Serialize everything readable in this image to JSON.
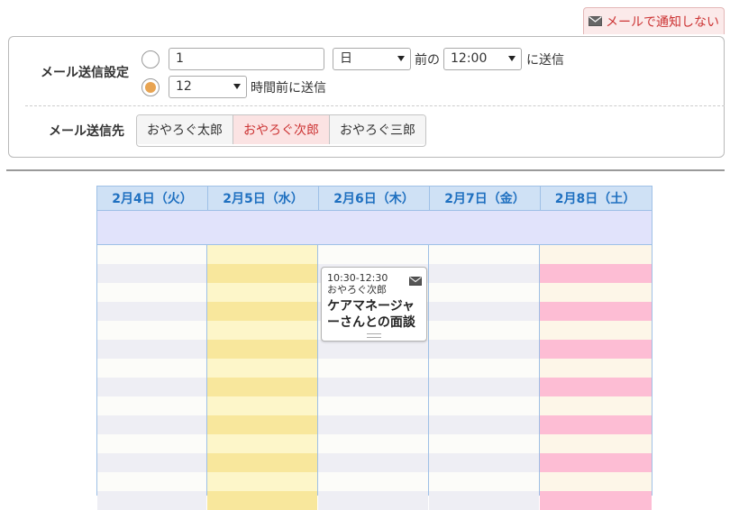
{
  "notify_button": {
    "label": "メールで通知しない",
    "icon": "mail-icon"
  },
  "settings": {
    "send_setting_label": "メール送信設定",
    "option1": {
      "selected": false,
      "number": "1",
      "unit": "日",
      "before_text": "前の",
      "time": "12:00",
      "after_text": "に送信"
    },
    "option2": {
      "selected": true,
      "hours": "12",
      "after_text": "時間前に送信"
    },
    "recipients_label": "メール送信先",
    "recipients": [
      {
        "label": "おやろぐ太郎",
        "active": false
      },
      {
        "label": "おやろぐ次郎",
        "active": true
      },
      {
        "label": "おやろぐ三郎",
        "active": false
      }
    ]
  },
  "calendar": {
    "days": [
      {
        "label": "2月4日（火）",
        "color": "#fcfcf9",
        "alt": "#eeeef4"
      },
      {
        "label": "2月5日（水）",
        "color": "#fdf6c9",
        "alt": "#f8e79c"
      },
      {
        "label": "2月6日（木）",
        "color": "#fcfcf9",
        "alt": "#eeeef4"
      },
      {
        "label": "2月7日（金）",
        "color": "#fcfcf9",
        "alt": "#eeeef4"
      },
      {
        "label": "2月8日（土）",
        "color": "#fdf6e8",
        "alt": "#fdbdd4"
      }
    ],
    "event": {
      "time": "10:30-12:30",
      "person": "おやろぐ次郎",
      "title_line1": "ケアマネージャ",
      "title_line2": "ーさんとの面談",
      "icon": "mail-icon"
    }
  },
  "colors": {
    "accent_red": "#cc3333",
    "header_blue": "#1f70c0",
    "radio_selected": "#e8a452"
  }
}
